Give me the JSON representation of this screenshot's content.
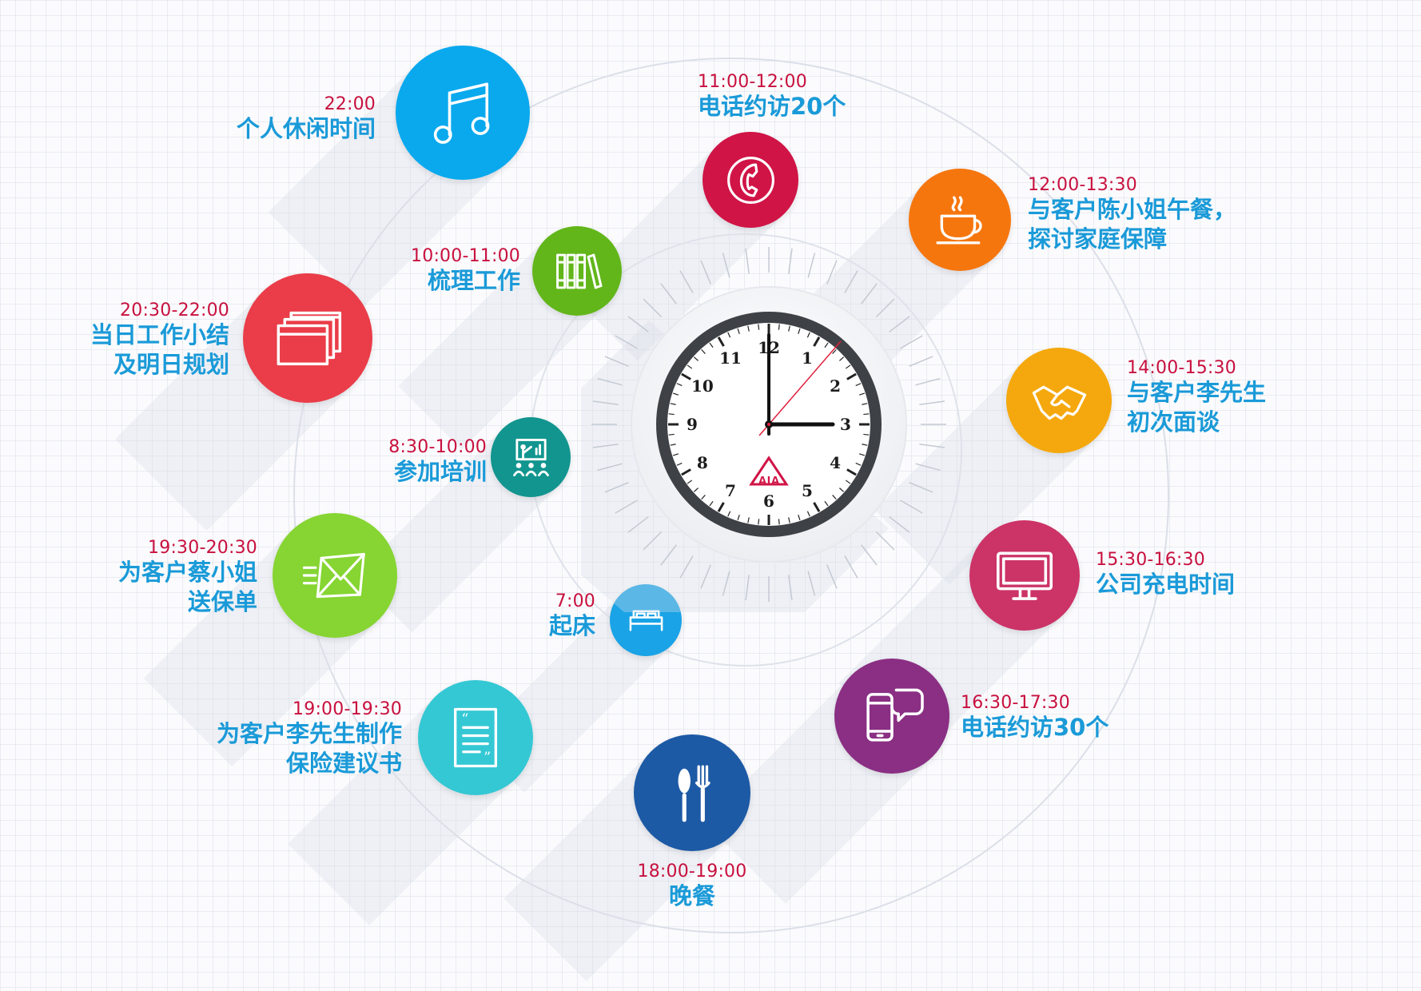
{
  "colors": {
    "time": "#c8103e",
    "desc": "#1a9ad8"
  },
  "clock": {
    "numerals": [
      "12",
      "1",
      "2",
      "3",
      "4",
      "5",
      "6",
      "7",
      "8",
      "9",
      "10",
      "11"
    ],
    "logo_text": "AIA",
    "hands": {
      "hour": "3:00"
    }
  },
  "events": [
    {
      "id": "wake",
      "time": "7:00",
      "lines": [
        "起床"
      ],
      "color": "#1aa3e6",
      "icon": "bed-icon"
    },
    {
      "id": "training",
      "time": "8:30-10:00",
      "lines": [
        "参加培训"
      ],
      "color": "#12958f",
      "icon": "presentation-icon"
    },
    {
      "id": "organize",
      "time": "10:00-11:00",
      "lines": [
        "梳理工作"
      ],
      "color": "#62b61a",
      "icon": "books-icon"
    },
    {
      "id": "calls20",
      "time": "11:00-12:00",
      "lines": [
        "电话约访20个"
      ],
      "color": "#d01446",
      "icon": "phone-icon"
    },
    {
      "id": "lunch",
      "time": "12:00-13:30",
      "lines": [
        "与客户陈小姐午餐，",
        "探讨家庭保障"
      ],
      "color": "#f6760e",
      "icon": "coffee-cup-icon"
    },
    {
      "id": "meeting",
      "time": "14:00-15:30",
      "lines": [
        "与客户李先生",
        "初次面谈"
      ],
      "color": "#f5a80d",
      "icon": "handshake-icon"
    },
    {
      "id": "charge",
      "time": "15:30-16:30",
      "lines": [
        "公司充电时间"
      ],
      "color": "#cc3367",
      "icon": "monitor-icon"
    },
    {
      "id": "calls30",
      "time": "16:30-17:30",
      "lines": [
        "电话约访30个"
      ],
      "color": "#8a2f83",
      "icon": "smartphone-chat-icon"
    },
    {
      "id": "dinner",
      "time": "18:00-19:00",
      "lines": [
        "晚餐"
      ],
      "color": "#1d5aa5",
      "icon": "cutlery-icon"
    },
    {
      "id": "proposal",
      "time": "19:00-19:30",
      "lines": [
        "为客户李先生制作",
        "保险建议书"
      ],
      "color": "#34c8d4",
      "icon": "document-icon"
    },
    {
      "id": "delivery",
      "time": "19:30-20:30",
      "lines": [
        "为客户蔡小姐",
        "送保单"
      ],
      "color": "#86d532",
      "icon": "mail-icon"
    },
    {
      "id": "summary",
      "time": "20:30-22:00",
      "lines": [
        "当日工作小结",
        "及明日规划"
      ],
      "color": "#ea3d49",
      "icon": "windows-icon"
    },
    {
      "id": "leisure",
      "time": "22:00",
      "lines": [
        "个人休闲时间"
      ],
      "color": "#0aa9ee",
      "icon": "music-note-icon"
    }
  ]
}
